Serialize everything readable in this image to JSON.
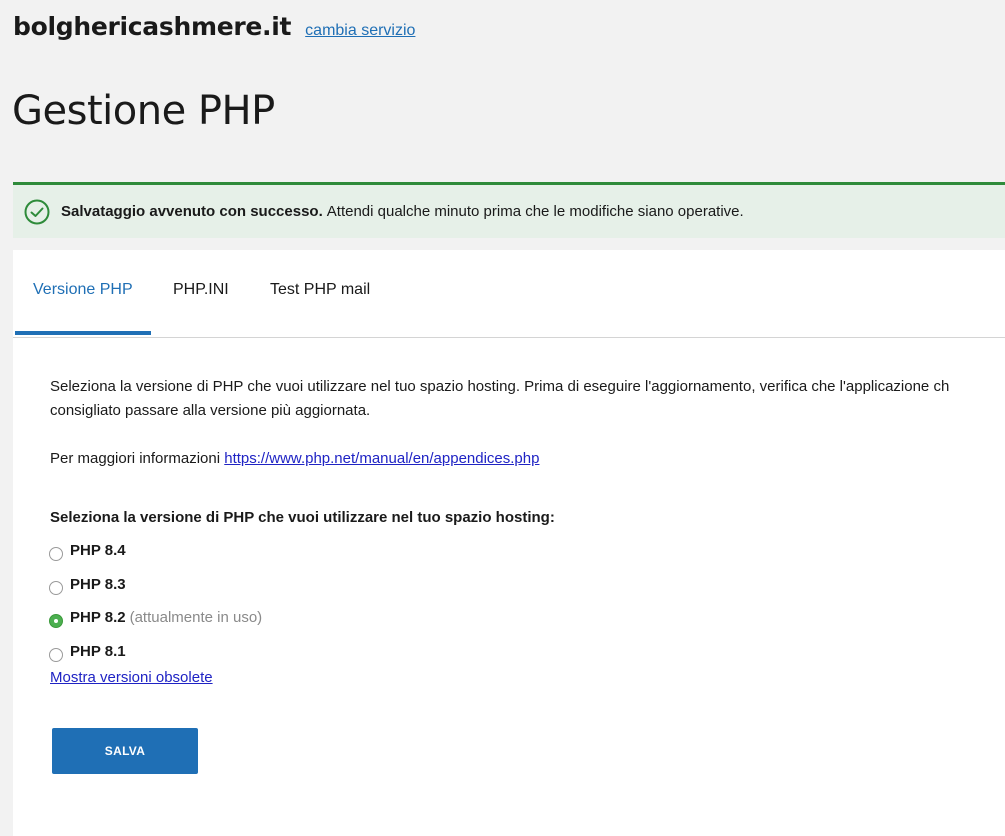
{
  "header": {
    "domain": "bolghericashmere.it",
    "change_link": "cambia servizio"
  },
  "page_title": "Gestione PHP",
  "alert": {
    "icon": "check-circle-icon",
    "bold_text": "Salvataggio avvenuto con successo.",
    "text": "Attendi qualche minuto prima che le modifiche siano operative.",
    "color": "#2e8b3a"
  },
  "tabs": [
    {
      "label": "Versione PHP",
      "active": true
    },
    {
      "label": "PHP.INI",
      "active": false
    },
    {
      "label": "Test PHP mail",
      "active": false
    }
  ],
  "content": {
    "description_line1": "Seleziona la versione di PHP che vuoi utilizzare nel tuo spazio hosting. Prima di eseguire l'aggiornamento, verifica che l'applicazione ch",
    "description_line2": "consigliato passare alla versione più aggiornata.",
    "info_prefix": "Per maggiori informazioni",
    "info_link": "https://www.php.net/manual/en/appendices.php",
    "select_label": "Seleziona la versione di PHP che vuoi utilizzare nel tuo spazio hosting:"
  },
  "php_options": [
    {
      "label": "PHP 8.4",
      "note": "",
      "checked": false
    },
    {
      "label": "PHP 8.3",
      "note": "",
      "checked": false
    },
    {
      "label": "PHP 8.2",
      "note": "(attualmente in uso)",
      "checked": true
    },
    {
      "label": "PHP 8.1",
      "note": "",
      "checked": false
    }
  ],
  "show_obsolete_link": "Mostra versioni obsolete",
  "save_button": "SALVA",
  "colors": {
    "accent": "#1f6fb5",
    "success": "#2e8b3a",
    "link": "#1f23c4"
  }
}
